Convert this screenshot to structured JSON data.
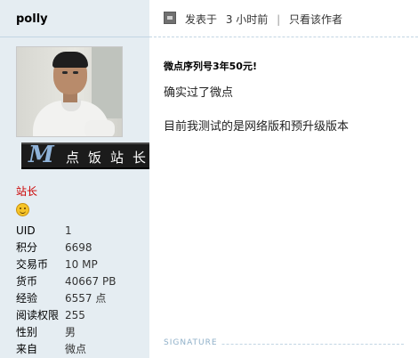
{
  "user": {
    "username": "polly",
    "badge_letter": "M",
    "badge_text": "点饭站长",
    "group": "站长"
  },
  "stats": [
    {
      "label": "UID",
      "value": "1"
    },
    {
      "label": "积分",
      "value": "6698"
    },
    {
      "label": "交易币",
      "value": "10 MP"
    },
    {
      "label": "货币",
      "value": "40667 PB"
    },
    {
      "label": "经验",
      "value": "6557 点"
    },
    {
      "label": "阅读权限",
      "value": "255"
    },
    {
      "label": "性别",
      "value": "男"
    },
    {
      "label": "来自",
      "value": "微点"
    }
  ],
  "post": {
    "posted_prefix": "发表于",
    "posted_time": "3 小时前",
    "separator": "|",
    "author_only_link": "只看该作者",
    "title": "微点序列号3年50元!",
    "lines": [
      "确实过了微点",
      "目前我测试的是网络版和预升级版本"
    ]
  },
  "signature": {
    "label": "SIGNATURE"
  },
  "colors": {
    "sidebar_bg": "#e5edf2",
    "group_red": "#cc0000",
    "signature_blue": "#8fb0c9"
  }
}
